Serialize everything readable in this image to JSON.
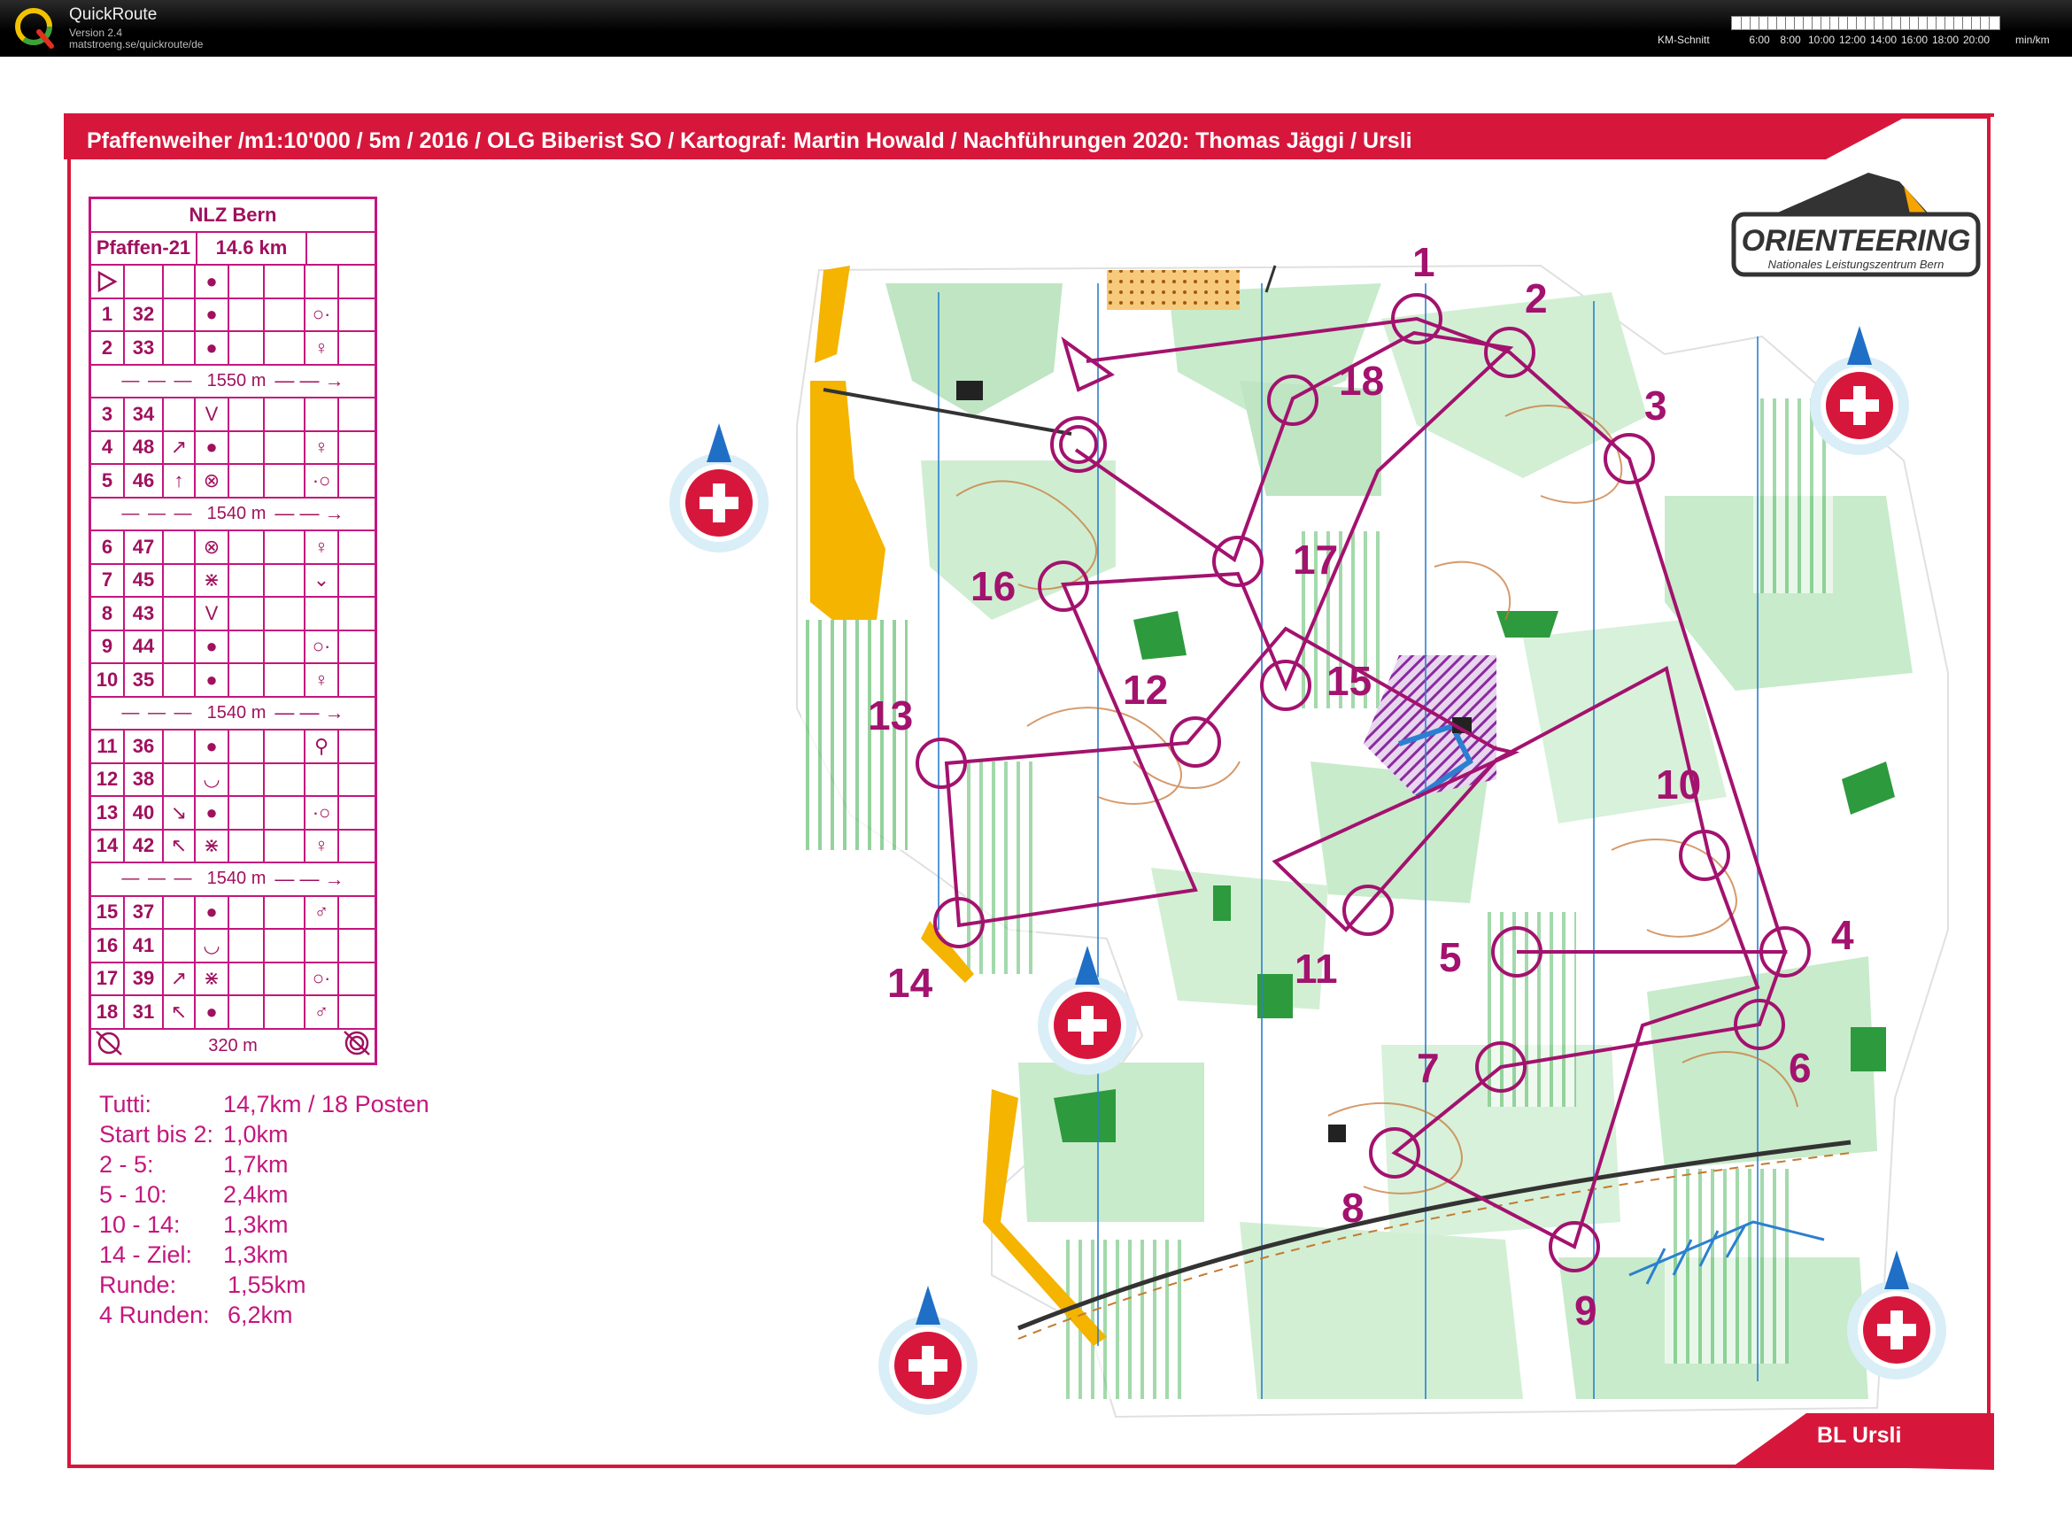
{
  "app": {
    "title": "QuickRoute",
    "version": "Version 2.4",
    "url": "matstroeng.se/quickroute/de",
    "speed_label": "KM-Schnitt",
    "speed_ticks": [
      "6:00",
      "8:00",
      "10:00",
      "12:00",
      "14:00",
      "16:00",
      "18:00",
      "20:00"
    ],
    "speed_unit": "min/km"
  },
  "map": {
    "title": "Pfaffenweiher /m1:10'000 / 5m / 2016 / OLG Biberist SO / Kartograf: Martin Howald / Nachführungen 2020: Thomas Jäggi / Ursli",
    "footer": "BL Ursli",
    "brand_text": "ORIENTEERING",
    "brand_sub": "Nationales Leistungszentrum Bern",
    "colors": {
      "course": "#a3126e",
      "frame": "#d6173b",
      "forest_green": "#5fb56a",
      "yellow": "#f4b400",
      "water": "#2c7fd0"
    },
    "control_labels": [
      "1",
      "2",
      "3",
      "4",
      "5",
      "6",
      "7",
      "8",
      "9",
      "10",
      "11",
      "12",
      "13",
      "14",
      "15",
      "16",
      "17",
      "18"
    ],
    "north_arrow_icon": "north-arrow-swiss-cross-icon"
  },
  "description": {
    "event": "NLZ Bern",
    "course": "Pfaffen-21",
    "length": "14.6 km",
    "start_symbol": "start-triangle-icon",
    "rows": [
      {
        "type": "control",
        "num": "1",
        "code": "32",
        "dir": "",
        "feature": "●",
        "detail": "",
        "extra": "○·"
      },
      {
        "type": "control",
        "num": "2",
        "code": "33",
        "dir": "",
        "feature": "●",
        "detail": "",
        "extra": "♀"
      },
      {
        "type": "leg",
        "text": "1550 m"
      },
      {
        "type": "control",
        "num": "3",
        "code": "34",
        "dir": "",
        "feature": "V",
        "detail": "",
        "extra": ""
      },
      {
        "type": "control",
        "num": "4",
        "code": "48",
        "dir": "↗",
        "feature": "●",
        "detail": "",
        "extra": "♀"
      },
      {
        "type": "control",
        "num": "5",
        "code": "46",
        "dir": "↑",
        "feature": "⊗",
        "detail": "",
        "extra": "·○"
      },
      {
        "type": "leg",
        "text": "1540 m"
      },
      {
        "type": "control",
        "num": "6",
        "code": "47",
        "dir": "",
        "feature": "⊗",
        "detail": "",
        "extra": "♀"
      },
      {
        "type": "control",
        "num": "7",
        "code": "45",
        "dir": "",
        "feature": "⋇",
        "detail": "",
        "extra": "⌄"
      },
      {
        "type": "control",
        "num": "8",
        "code": "43",
        "dir": "",
        "feature": "V",
        "detail": "",
        "extra": ""
      },
      {
        "type": "control",
        "num": "9",
        "code": "44",
        "dir": "",
        "feature": "●",
        "detail": "",
        "extra": "○·"
      },
      {
        "type": "control",
        "num": "10",
        "code": "35",
        "dir": "",
        "feature": "●",
        "detail": "",
        "extra": "♀"
      },
      {
        "type": "leg",
        "text": "1540 m"
      },
      {
        "type": "control",
        "num": "11",
        "code": "36",
        "dir": "",
        "feature": "●",
        "detail": "",
        "extra": "⚲"
      },
      {
        "type": "control",
        "num": "12",
        "code": "38",
        "dir": "",
        "feature": "◡",
        "detail": "",
        "extra": ""
      },
      {
        "type": "control",
        "num": "13",
        "code": "40",
        "dir": "↘",
        "feature": "●",
        "detail": "",
        "extra": "·○"
      },
      {
        "type": "control",
        "num": "14",
        "code": "42",
        "dir": "↖",
        "feature": "⋇",
        "detail": "",
        "extra": "♀"
      },
      {
        "type": "leg",
        "text": "1540 m"
      },
      {
        "type": "control",
        "num": "15",
        "code": "37",
        "dir": "",
        "feature": "●",
        "detail": "",
        "extra": "♂"
      },
      {
        "type": "control",
        "num": "16",
        "code": "41",
        "dir": "",
        "feature": "◡",
        "detail": "",
        "extra": ""
      },
      {
        "type": "control",
        "num": "17",
        "code": "39",
        "dir": "↗",
        "feature": "⋇",
        "detail": "",
        "extra": "○·"
      },
      {
        "type": "control",
        "num": "18",
        "code": "31",
        "dir": "↖",
        "feature": "●",
        "detail": "",
        "extra": "♂"
      },
      {
        "type": "finish",
        "text": "320 m"
      }
    ]
  },
  "legs": [
    {
      "label": "Tutti:",
      "value": "14,7km / 18 Posten"
    },
    {
      "label": "Start bis 2:",
      "value": "1,0km"
    },
    {
      "label": "2 - 5:",
      "value": "1,7km"
    },
    {
      "label": "5 - 10:",
      "value": "2,4km"
    },
    {
      "label": "10 - 14:",
      "value": "1,3km"
    },
    {
      "label": "14 - Ziel:",
      "value": "1,3km"
    },
    {
      "label": "Runde:",
      "value": "1,55km"
    },
    {
      "label": "4 Runden:",
      "value": "6,2km"
    }
  ]
}
